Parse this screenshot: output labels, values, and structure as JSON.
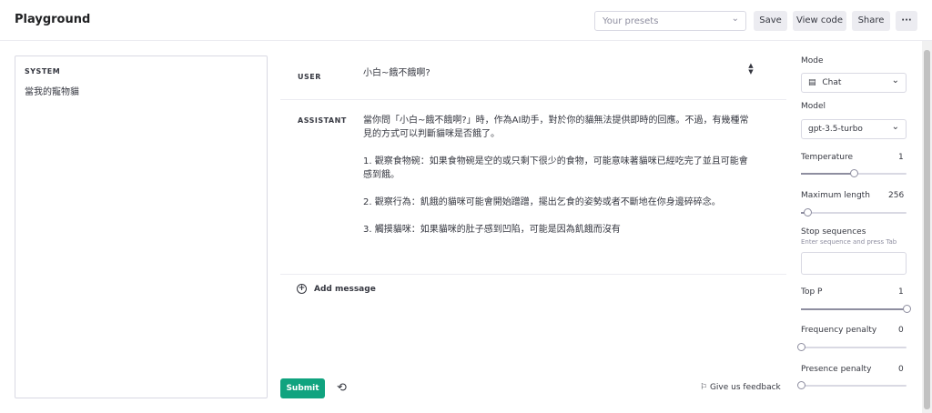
{
  "header": {
    "title": "Playground",
    "presets_placeholder": "Your presets",
    "save_label": "Save",
    "view_code_label": "View code",
    "share_label": "Share",
    "more_label": "···"
  },
  "system": {
    "label": "SYSTEM",
    "text": "當我的寵物貓"
  },
  "messages": {
    "user_role": "USER",
    "user_text": "小白~餓不餓啊?",
    "assistant_role": "ASSISTANT",
    "assistant_paragraphs": [
      "當你問「小白~餓不餓啊?」時，作為AI助手，對於你的貓無法提供即時的回應。不過，有幾種常見的方式可以判斷貓咪是否餓了。",
      "1. 觀察食物碗：如果食物碗是空的或只剩下很少的食物，可能意味著貓咪已經吃完了並且可能會感到餓。",
      "2. 觀察行為：飢餓的貓咪可能會開始蹭蹭，擺出乞食的姿勢或者不斷地在你身邊碎碎念。",
      "3. 觸摸貓咪：如果貓咪的肚子感到凹陷，可能是因為飢餓而沒有"
    ],
    "add_message_label": "Add message"
  },
  "footer": {
    "submit_label": "Submit",
    "feedback_label": "Give us feedback"
  },
  "settings": {
    "mode_label": "Mode",
    "mode_value": "Chat",
    "model_label": "Model",
    "model_value": "gpt-3.5-turbo",
    "temperature_label": "Temperature",
    "temperature_value": "1",
    "max_length_label": "Maximum length",
    "max_length_value": "256",
    "stop_label": "Stop sequences",
    "stop_hint": "Enter sequence and press Tab",
    "top_p_label": "Top P",
    "top_p_value": "1",
    "freq_label": "Frequency penalty",
    "freq_value": "0",
    "presence_label": "Presence penalty",
    "presence_value": "0"
  },
  "sliders": {
    "temperature_fraction": 0.5,
    "max_length_fraction": 0.06,
    "top_p_fraction": 1.0,
    "frequency_fraction": 0.0,
    "presence_fraction": 0.0
  },
  "colors": {
    "accent": "#10a37f"
  },
  "icons": {
    "presets": "chevron-down-icon",
    "more": "more-icon",
    "spinner": "stepper-icon",
    "add": "plus-circle-icon",
    "history": "history-icon",
    "feedback": "flag-icon",
    "mode": "chat-icon",
    "model": "chevron-down-icon"
  }
}
